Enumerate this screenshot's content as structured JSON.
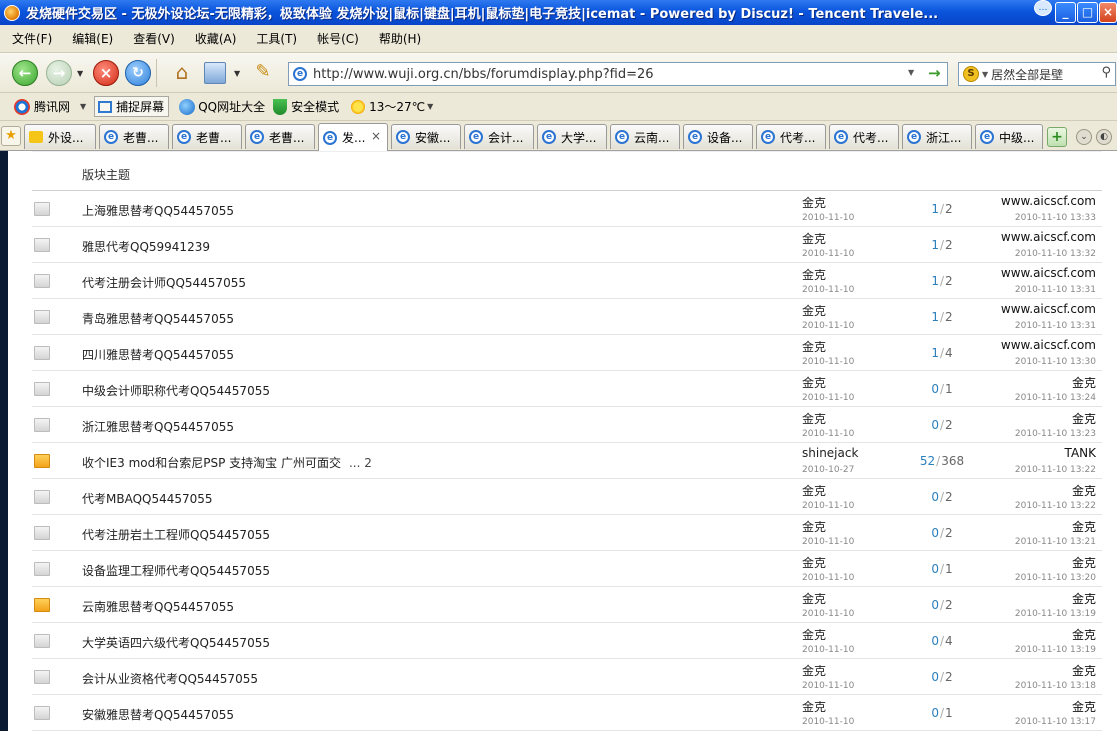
{
  "window": {
    "title": "发烧硬件交易区 - 无极外设论坛-无限精彩，极致体验 发烧外设|鼠标|键盘|耳机|鼠标垫|电子竞技|icemat - Powered by Discuz! - Tencent Travele..."
  },
  "menu": [
    "文件(F)",
    "编辑(E)",
    "查看(V)",
    "收藏(A)",
    "工具(T)",
    "帐号(C)",
    "帮助(H)"
  ],
  "address": {
    "url": "http://www.wuji.org.cn/bbs/forumdisplay.php?fid=26"
  },
  "search": {
    "text": "居然全部是壁"
  },
  "links": {
    "tencent": "腾讯网",
    "capture": "捕捉屏幕",
    "qq_nav": "QQ网址大全",
    "safe_mode": "安全模式",
    "weather": "13～27℃"
  },
  "tabs": [
    {
      "label": "外设..."
    },
    {
      "label": "老曹..."
    },
    {
      "label": "老曹..."
    },
    {
      "label": "老曹..."
    },
    {
      "label": "发..."
    },
    {
      "label": "安徽..."
    },
    {
      "label": "会计..."
    },
    {
      "label": "大学..."
    },
    {
      "label": "云南..."
    },
    {
      "label": "设备..."
    },
    {
      "label": "代考..."
    },
    {
      "label": "代考..."
    },
    {
      "label": "浙江..."
    },
    {
      "label": "中级..."
    }
  ],
  "forum": {
    "header": "版块主题",
    "threads": [
      {
        "title": "上海雅思替考QQ54457055",
        "author": "金克",
        "date": "2010-11-10",
        "replies": "1",
        "views": "2",
        "last_poster": "www.aicscf.com",
        "last_time": "2010-11-10 13:33",
        "icon": "normal"
      },
      {
        "title": "雅思代考QQ59941239",
        "author": "金克",
        "date": "2010-11-10",
        "replies": "1",
        "views": "2",
        "last_poster": "www.aicscf.com",
        "last_time": "2010-11-10 13:32",
        "icon": "normal"
      },
      {
        "title": "代考注册会计师QQ54457055",
        "author": "金克",
        "date": "2010-11-10",
        "replies": "1",
        "views": "2",
        "last_poster": "www.aicscf.com",
        "last_time": "2010-11-10 13:31",
        "icon": "normal"
      },
      {
        "title": "青岛雅思替考QQ54457055",
        "author": "金克",
        "date": "2010-11-10",
        "replies": "1",
        "views": "2",
        "last_poster": "www.aicscf.com",
        "last_time": "2010-11-10 13:31",
        "icon": "normal"
      },
      {
        "title": "四川雅思替考QQ54457055",
        "author": "金克",
        "date": "2010-11-10",
        "replies": "1",
        "views": "4",
        "last_poster": "www.aicscf.com",
        "last_time": "2010-11-10 13:30",
        "icon": "normal"
      },
      {
        "title": "中级会计师职称代考QQ54457055",
        "author": "金克",
        "date": "2010-11-10",
        "replies": "0",
        "views": "1",
        "last_poster": "金克",
        "last_time": "2010-11-10 13:24",
        "icon": "normal"
      },
      {
        "title": "浙江雅思替考QQ54457055",
        "author": "金克",
        "date": "2010-11-10",
        "replies": "0",
        "views": "2",
        "last_poster": "金克",
        "last_time": "2010-11-10 13:23",
        "icon": "normal"
      },
      {
        "title": "收个IE3 mod和台索尼PSP 支持淘宝  广州可面交",
        "pages": "... 2",
        "author": "shinejack",
        "date": "2010-10-27",
        "replies": "52",
        "views": "368",
        "last_poster": "TANK",
        "last_time": "2010-11-10 13:22",
        "icon": "hot"
      },
      {
        "title": "代考MBAQQ54457055",
        "author": "金克",
        "date": "2010-11-10",
        "replies": "0",
        "views": "2",
        "last_poster": "金克",
        "last_time": "2010-11-10 13:22",
        "icon": "normal"
      },
      {
        "title": "代考注册岩土工程师QQ54457055",
        "author": "金克",
        "date": "2010-11-10",
        "replies": "0",
        "views": "2",
        "last_poster": "金克",
        "last_time": "2010-11-10 13:21",
        "icon": "normal"
      },
      {
        "title": "设备监理工程师代考QQ54457055",
        "author": "金克",
        "date": "2010-11-10",
        "replies": "0",
        "views": "1",
        "last_poster": "金克",
        "last_time": "2010-11-10 13:20",
        "icon": "normal"
      },
      {
        "title": "云南雅思替考QQ54457055",
        "author": "金克",
        "date": "2010-11-10",
        "replies": "0",
        "views": "2",
        "last_poster": "金克",
        "last_time": "2010-11-10 13:19",
        "icon": "hot"
      },
      {
        "title": "大学英语四六级代考QQ54457055",
        "author": "金克",
        "date": "2010-11-10",
        "replies": "0",
        "views": "4",
        "last_poster": "金克",
        "last_time": "2010-11-10 13:19",
        "icon": "normal"
      },
      {
        "title": "会计从业资格代考QQ54457055",
        "author": "金克",
        "date": "2010-11-10",
        "replies": "0",
        "views": "2",
        "last_poster": "金克",
        "last_time": "2010-11-10 13:18",
        "icon": "normal"
      },
      {
        "title": "安徽雅思替考QQ54457055",
        "author": "金克",
        "date": "2010-11-10",
        "replies": "0",
        "views": "1",
        "last_poster": "金克",
        "last_time": "2010-11-10 13:17",
        "icon": "normal"
      }
    ]
  }
}
